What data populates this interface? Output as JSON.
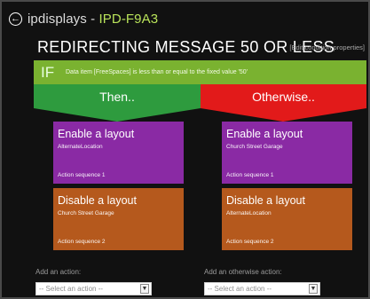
{
  "header": {
    "back_icon": "back-arrow-icon",
    "brand": "ipdisplays",
    "separator": " - ",
    "device_id": "IPD-F9A3"
  },
  "rule": {
    "title": "Redirecting message 50 or less",
    "edit_link": "[Edit condition properties]"
  },
  "condition": {
    "if_label": "IF",
    "text": "Data item [FreeSpaces] is less than or equal to the fixed value '50'"
  },
  "branches": {
    "then_label": "Then..",
    "otherwise_label": "Otherwise.."
  },
  "then_actions": [
    {
      "title": "Enable a layout",
      "target": "AlternateLocation",
      "sequence": "Action sequence 1"
    },
    {
      "title": "Disable a layout",
      "target": "Church Street Garage",
      "sequence": "Action sequence 2"
    }
  ],
  "otherwise_actions": [
    {
      "title": "Enable a layout",
      "target": "Church Street Garage",
      "sequence": "Action sequence 1"
    },
    {
      "title": "Disable a layout",
      "target": "AlternateLocation",
      "sequence": "Action sequence 2"
    }
  ],
  "add_action": {
    "label": "Add an action:",
    "select_value": "-- Select an action --"
  },
  "add_otherwise_action": {
    "label": "Add an otherwise action:",
    "select_value": "-- Select an action --"
  },
  "colors": {
    "if_bar": "#7ab230",
    "then_bar": "#2e9b3e",
    "otherwise_bar": "#e21a1a",
    "enable_tile": "#8a2aa4",
    "disable_tile": "#b5591d",
    "device_id": "#b9e35a"
  }
}
